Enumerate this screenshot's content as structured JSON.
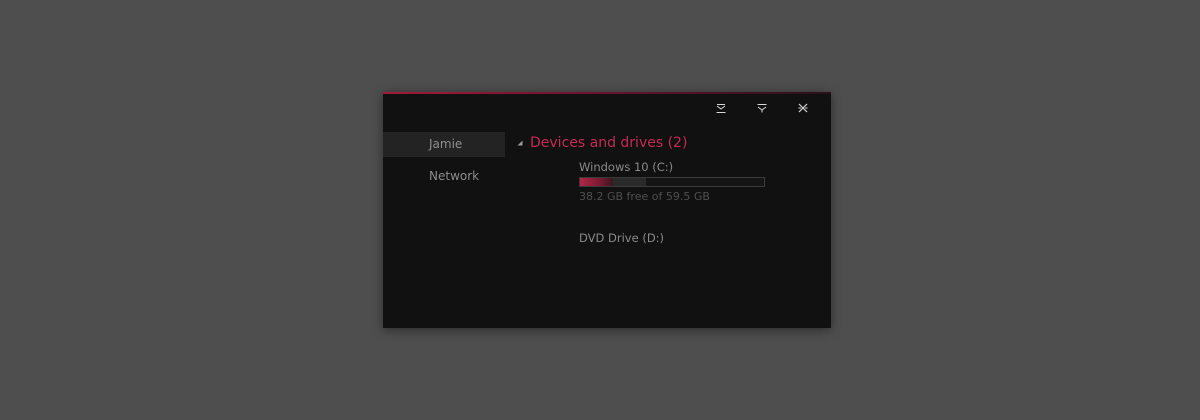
{
  "window": {
    "accent_color": "#c72a55",
    "caption_buttons": [
      {
        "icon": "minimize-icon"
      },
      {
        "icon": "maximize-icon"
      },
      {
        "icon": "close-icon"
      }
    ]
  },
  "sidebar": {
    "items": [
      {
        "label": "Jamie",
        "selected": true
      },
      {
        "label": "Network",
        "selected": false
      }
    ]
  },
  "main": {
    "group": {
      "title": "Devices and drives (2)",
      "expanded": true,
      "arrow_icon": "collapse-arrow-icon"
    },
    "drives": [
      {
        "name": "Windows 10 (C:)",
        "free_text": "38.2 GB free of 59.5 GB",
        "used_fraction": 0.358
      },
      {
        "name": "DVD Drive (D:)"
      }
    ]
  }
}
